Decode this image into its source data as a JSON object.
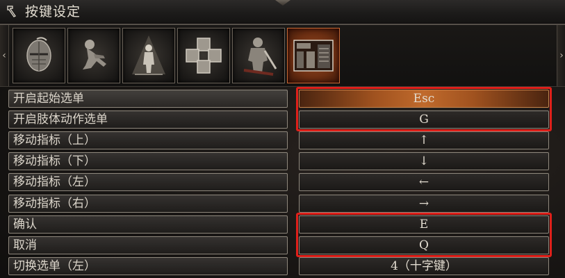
{
  "window": {
    "title": "按键设定",
    "title_icon": "hammer-icon"
  },
  "tabs": [
    {
      "name": "helmet-icon",
      "active": false
    },
    {
      "name": "crouching-figure-icon",
      "active": false
    },
    {
      "name": "standing-figure-icon",
      "active": false
    },
    {
      "name": "card-grid-icon",
      "active": false
    },
    {
      "name": "knight-icon",
      "active": false
    },
    {
      "name": "controller-settings-icon",
      "active": true
    }
  ],
  "nav": {
    "left_arrow": "‹",
    "right_arrow": "›"
  },
  "rows": [
    {
      "label": "开启起始选单",
      "value": "Esc",
      "selected": true
    },
    {
      "label": "开启肢体动作选单",
      "value": "G",
      "selected": false
    },
    {
      "label": "移动指标（上）",
      "value": "↑",
      "selected": false
    },
    {
      "label": "移动指标（下）",
      "value": "↓",
      "selected": false
    },
    {
      "label": "移动指标（左）",
      "value": "←",
      "selected": false
    },
    {
      "label": "移动指标（右）",
      "value": "→",
      "selected": false
    },
    {
      "label": "确认",
      "value": "E",
      "selected": false
    },
    {
      "label": "取消",
      "value": "Q",
      "selected": false
    },
    {
      "label": "切换选单（左）",
      "value": "4（十字键）",
      "selected": false
    }
  ],
  "colors": {
    "highlight": "#e0201a",
    "active_tab": "#9a4a22"
  }
}
